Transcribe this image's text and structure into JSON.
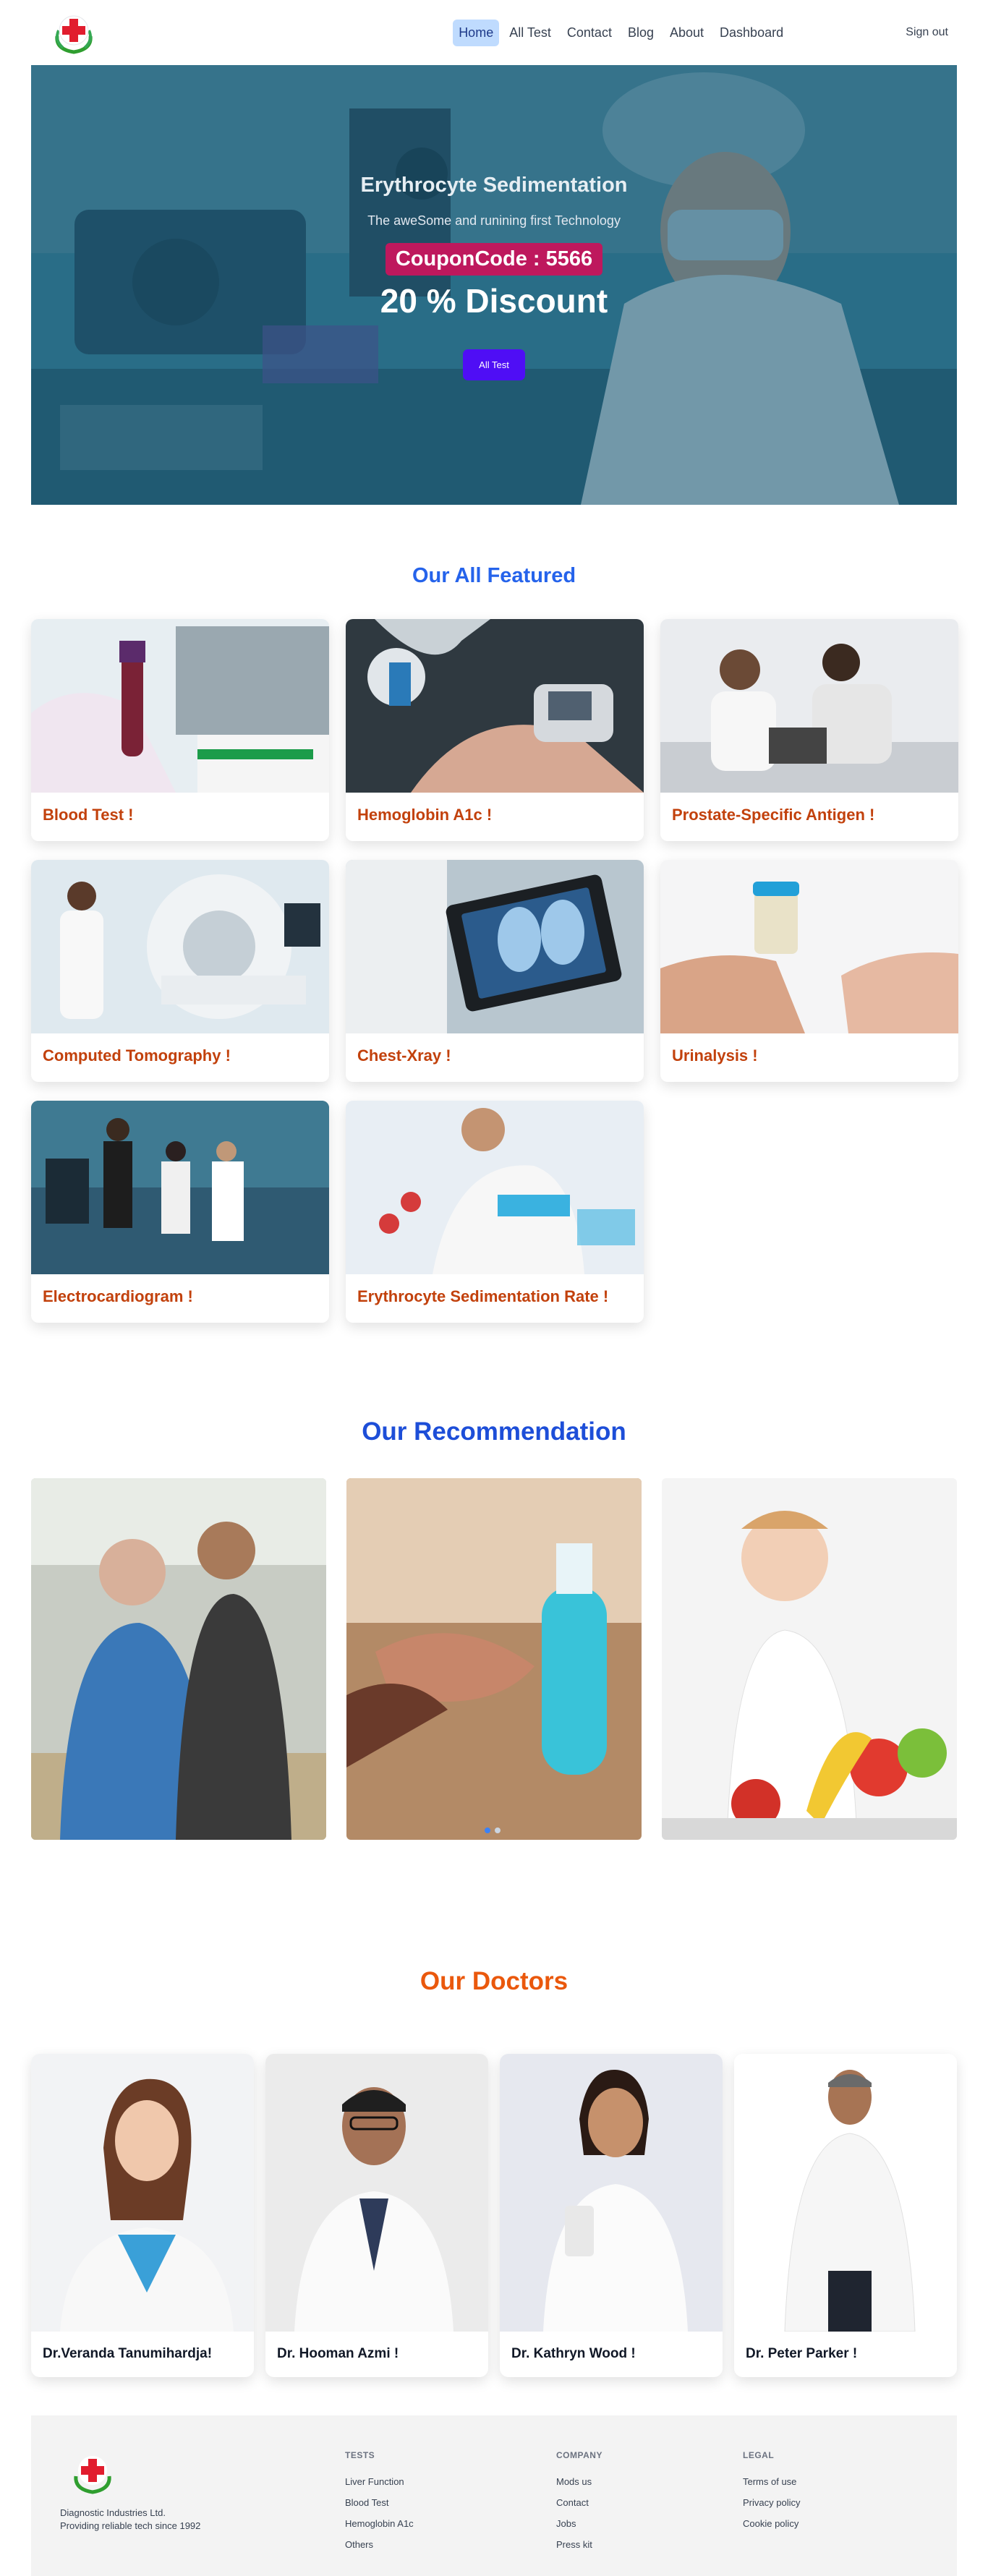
{
  "nav": {
    "links": [
      {
        "label": "Home",
        "active": true
      },
      {
        "label": "All Test"
      },
      {
        "label": "Contact"
      },
      {
        "label": "Blog"
      },
      {
        "label": "About"
      },
      {
        "label": "Dashboard"
      }
    ],
    "signout": "Sign out"
  },
  "hero": {
    "title": "Erythrocyte Sedimentation",
    "subtitle": "The aweSome and runining first Technology",
    "coupon": "CouponCode : 5566",
    "discount": "20 % Discount",
    "button": "All Test"
  },
  "featured": {
    "title": "Our All Featured",
    "title_color": "#2563eb",
    "items": [
      {
        "label": "Blood Test !"
      },
      {
        "label": "Hemoglobin A1c !"
      },
      {
        "label": "Prostate-Specific Antigen !"
      },
      {
        "label": "Computed Tomography !"
      },
      {
        "label": "Chest-Xray !"
      },
      {
        "label": "Urinalysis !"
      },
      {
        "label": "Electrocardiogram !"
      },
      {
        "label": "Erythrocyte Sedimentation Rate !"
      }
    ]
  },
  "recommendation": {
    "title": "Our Recommendation",
    "title_color": "#1d4ed8",
    "carousel_active_index": 0
  },
  "doctors": {
    "title": "Our Doctors",
    "title_color": "#ea580c",
    "items": [
      {
        "name": "Dr.Veranda Tanumihardja!"
      },
      {
        "name": "Dr. Hooman Azmi !"
      },
      {
        "name": "Dr. Kathryn Wood !"
      },
      {
        "name": "Dr. Peter Parker !"
      }
    ]
  },
  "footer": {
    "company_name": "Diagnostic Industries Ltd.",
    "tagline": "Providing reliable tech since 1992",
    "columns": [
      {
        "heading": "TESTS",
        "links": [
          "Liver Function",
          "Blood Test",
          "Hemoglobin A1c",
          "Others"
        ]
      },
      {
        "heading": "COMPANY",
        "links": [
          "Mods us",
          "Contact",
          "Jobs",
          "Press kit"
        ]
      },
      {
        "heading": "LEGAL",
        "links": [
          "Terms of use",
          "Privacy policy",
          "Cookie policy"
        ]
      }
    ]
  },
  "colors": {
    "accent_button": "#4f0ef5",
    "coupon_bg": "#be185d",
    "card_label": "#c2410c"
  },
  "icons": [
    "medical-cross-logo-icon"
  ]
}
